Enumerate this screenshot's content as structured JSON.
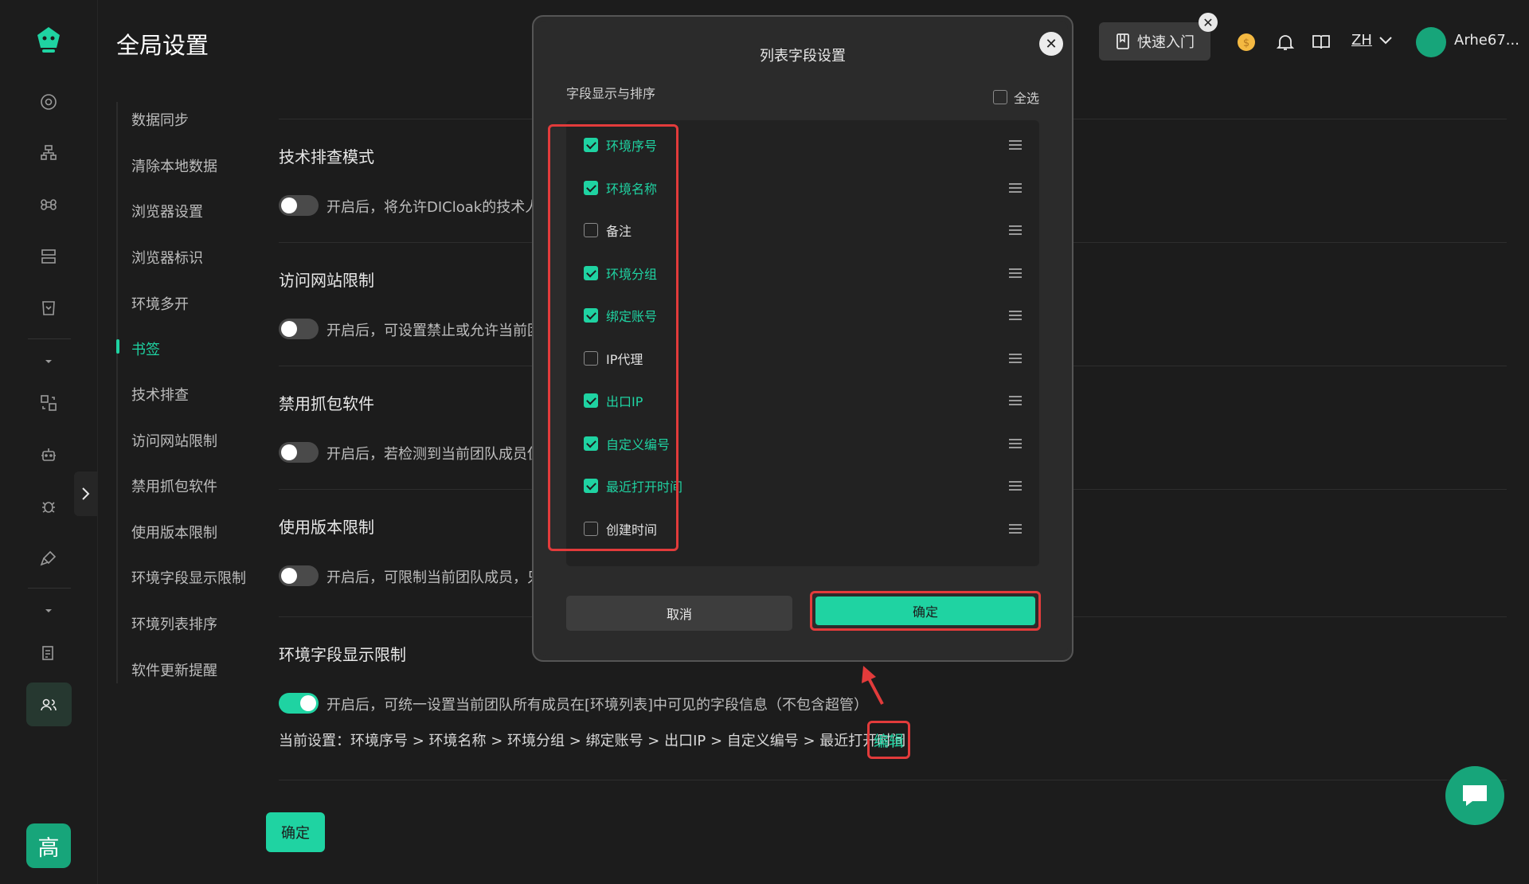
{
  "page": {
    "title": "全局设置"
  },
  "subnav": {
    "items": [
      {
        "label": "数据同步"
      },
      {
        "label": "清除本地数据"
      },
      {
        "label": "浏览器设置"
      },
      {
        "label": "浏览器标识"
      },
      {
        "label": "环境多开"
      },
      {
        "label": "书签"
      },
      {
        "label": "技术排查"
      },
      {
        "label": "访问网站限制"
      },
      {
        "label": "禁用抓包软件"
      },
      {
        "label": "使用版本限制"
      },
      {
        "label": "环境字段显示限制"
      },
      {
        "label": "环境列表排序"
      },
      {
        "label": "软件更新提醒"
      }
    ],
    "active_index": 5
  },
  "sections": [
    {
      "title": "技术排查模式",
      "desc": "开启后，将允许DICloak的技术人员",
      "enabled": false
    },
    {
      "title": "访问网站限制",
      "desc": "开启后，可设置禁止或允许当前团",
      "enabled": false
    },
    {
      "title": "禁用抓包软件",
      "desc": "开启后，若检测到当前团队成员使",
      "enabled": false
    },
    {
      "title": "使用版本限制",
      "desc": "开启后，可限制当前团队成员，只",
      "enabled": false
    },
    {
      "title": "环境字段显示限制",
      "desc": "开启后，可统一设置当前团队所有成员在[环境列表]中可见的字段信息（不包含超管）",
      "enabled": true
    }
  ],
  "current_setting": {
    "text": "当前设置：环境序号 > 环境名称 > 环境分组 > 绑定账号 > 出口IP > 自定义编号 > 最近打开时间",
    "edit_label": "编辑"
  },
  "main_confirm": "确定",
  "topbar": {
    "quick_start": "快速入门",
    "lang": "ZH",
    "username": "Arhe67..."
  },
  "rail": {
    "avatar_char": "高"
  },
  "modal": {
    "title": "列表字段设置",
    "subtitle": "字段显示与排序",
    "select_all": "全选",
    "fields": [
      {
        "label": "环境序号",
        "checked": true
      },
      {
        "label": "环境名称",
        "checked": true
      },
      {
        "label": "备注",
        "checked": false
      },
      {
        "label": "环境分组",
        "checked": true
      },
      {
        "label": "绑定账号",
        "checked": true
      },
      {
        "label": "IP代理",
        "checked": false
      },
      {
        "label": "出口IP",
        "checked": true
      },
      {
        "label": "自定义编号",
        "checked": true
      },
      {
        "label": "最近打开时间",
        "checked": true
      },
      {
        "label": "创建时间",
        "checked": false
      }
    ],
    "cancel": "取消",
    "confirm": "确定"
  },
  "colors": {
    "accent": "#1fd3a2",
    "highlight": "#e23b3b",
    "background": "#1c1c1c"
  }
}
